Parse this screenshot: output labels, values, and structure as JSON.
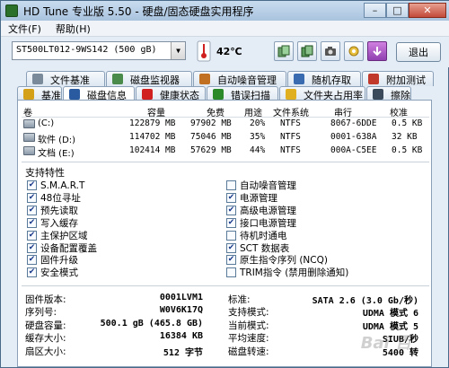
{
  "window": {
    "title": "HD Tune 专业版 5.50 - 硬盘/固态硬盘实用程序"
  },
  "titlebar": {
    "minimize": "–",
    "maximize": "□",
    "close": "✕"
  },
  "menu": {
    "file": "文件(F)",
    "help": "帮助(H)"
  },
  "toolbar": {
    "drive": "ST500LT012-9WS142 (500 gB)",
    "temperature": "42℃",
    "exit_label": "退出"
  },
  "tabs": {
    "row1": [
      {
        "label": "文件基准",
        "icon": "file-benchmark-icon",
        "color": "#7a8a9a"
      },
      {
        "label": "磁盘监视器",
        "icon": "disk-monitor-icon",
        "color": "#4a8a4a"
      },
      {
        "label": "自动噪音管理",
        "icon": "noise-icon",
        "color": "#c07020"
      },
      {
        "label": "随机存取",
        "icon": "random-access-icon",
        "color": "#3a6ab0"
      },
      {
        "label": "附加测试",
        "icon": "extra-tests-icon",
        "color": "#c0392b"
      }
    ],
    "row2": [
      {
        "label": "基准",
        "icon": "benchmark-icon",
        "color": "#d4a017"
      },
      {
        "label": "磁盘信息",
        "icon": "disk-info-icon",
        "color": "#2a5aa0"
      },
      {
        "label": "健康状态",
        "icon": "health-icon",
        "color": "#d02020"
      },
      {
        "label": "错误扫描",
        "icon": "error-scan-icon",
        "color": "#2a8a2a"
      },
      {
        "label": "文件夹占用率",
        "icon": "folder-usage-icon",
        "color": "#e0b020"
      },
      {
        "label": "擦除",
        "icon": "erase-icon",
        "color": "#3a4a5a"
      }
    ]
  },
  "volumes": {
    "headers": [
      "卷",
      "容量",
      "免费",
      "用途",
      "文件系统",
      "串行",
      "校准"
    ],
    "rows": [
      {
        "name": "(C:)",
        "capacity": "122879 MB",
        "free": "97902 MB",
        "usage": "20%",
        "fs": "NTFS",
        "serial": "8067-6DDE",
        "cluster": "0.5 KB"
      },
      {
        "name": "软件 (D:)",
        "capacity": "114702 MB",
        "free": "75046 MB",
        "usage": "35%",
        "fs": "NTFS",
        "serial": "0001-638A",
        "cluster": "32 KB"
      },
      {
        "name": "文档 (E:)",
        "capacity": "102414 MB",
        "free": "57629 MB",
        "usage": "44%",
        "fs": "NTFS",
        "serial": "000A-C5EE",
        "cluster": "0.5 KB"
      }
    ]
  },
  "features": {
    "title": "支持特性",
    "left": [
      {
        "label": "S.M.A.R.T",
        "checked": true
      },
      {
        "label": "48位寻址",
        "checked": true
      },
      {
        "label": "预先读取",
        "checked": true
      },
      {
        "label": "写入缓存",
        "checked": true
      },
      {
        "label": "主保护区域",
        "checked": true
      },
      {
        "label": "设备配置覆盖",
        "checked": true
      },
      {
        "label": "固件升级",
        "checked": true
      },
      {
        "label": "安全模式",
        "checked": true
      }
    ],
    "right": [
      {
        "label": "自动噪音管理",
        "checked": false
      },
      {
        "label": "电源管理",
        "checked": true
      },
      {
        "label": "高级电源管理",
        "checked": true
      },
      {
        "label": "接口电源管理",
        "checked": true
      },
      {
        "label": "待机时通电",
        "checked": false
      },
      {
        "label": "SCT 数据表",
        "checked": true
      },
      {
        "label": "原生指令序列 (NCQ)",
        "checked": true
      },
      {
        "label": "TRIM指令 (禁用删除通知)",
        "checked": false
      }
    ]
  },
  "info": {
    "left": [
      {
        "label": "固件版本:",
        "value": "0001LVM1"
      },
      {
        "label": "序列号:",
        "value": "W0V6K17Q"
      },
      {
        "label": "硬盘容量:",
        "value": "500.1 gB (465.8 GB)"
      },
      {
        "label": "缓存大小:",
        "value": "16384 KB"
      },
      {
        "label": "扇区大小:",
        "value": "512 字节"
      }
    ],
    "right": [
      {
        "label": "标准:",
        "value": "SATA 2.6 (3.0 Gb/秒)"
      },
      {
        "label": "支持模式:",
        "value": "UDMA 模式 6"
      },
      {
        "label": "当前模式:",
        "value": "UDMA 模式 5"
      },
      {
        "label": "平均速度:",
        "value": "SIUB/秒"
      },
      {
        "label": "磁盘转速:",
        "value": "5400 转"
      }
    ]
  },
  "watermark": "Bai 百"
}
